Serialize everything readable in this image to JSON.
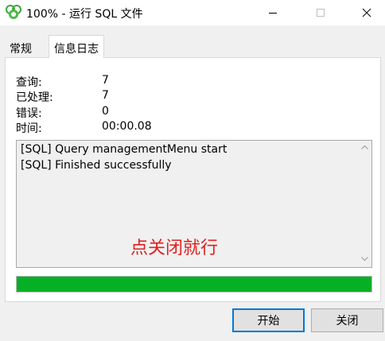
{
  "window": {
    "title": "100% - 运行 SQL 文件",
    "icon": "navicat-logo-icon",
    "controls": [
      "minimize-icon",
      "maximize-icon",
      "close-icon"
    ]
  },
  "tabs": [
    {
      "label": "常规",
      "active": false
    },
    {
      "label": "信息日志",
      "active": true
    }
  ],
  "stats": [
    {
      "label": "查询:",
      "value": "7"
    },
    {
      "label": "已处理:",
      "value": "7"
    },
    {
      "label": "错误:",
      "value": "0"
    },
    {
      "label": "时间:",
      "value": "00:00.08"
    }
  ],
  "log": {
    "lines": [
      "[SQL] Query managementMenu start",
      "[SQL] Finished successfully"
    ]
  },
  "annotation": {
    "text": "点关闭就行",
    "color": "#e02020"
  },
  "progress": {
    "fraction": 1.0,
    "color": "#06b025"
  },
  "buttons": {
    "start": "开始",
    "close": "关闭"
  },
  "colors": {
    "accent": "#0078d7",
    "progress": "#06b025"
  }
}
